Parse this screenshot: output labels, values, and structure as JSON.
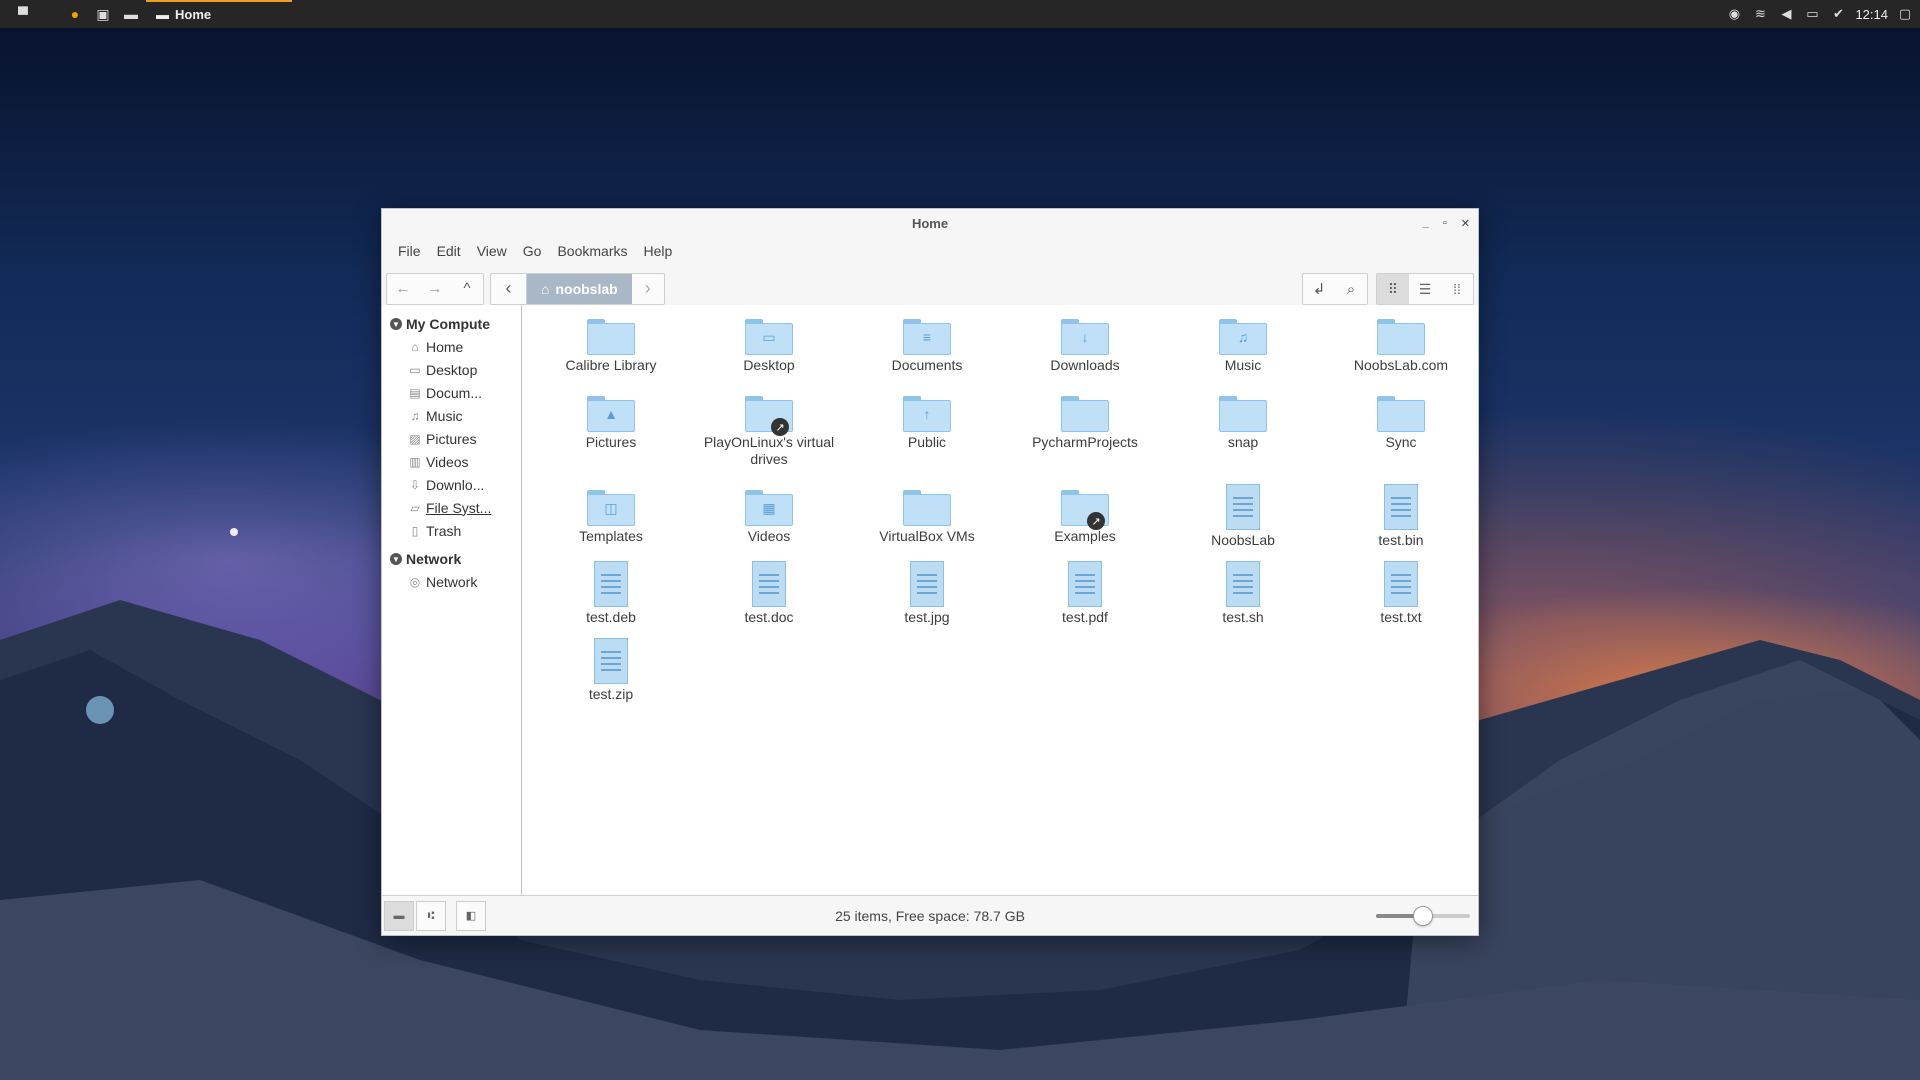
{
  "panel": {
    "task_label": "Home",
    "clock": "12:14"
  },
  "window": {
    "title": "Home",
    "menu": [
      "File",
      "Edit",
      "View",
      "Go",
      "Bookmarks",
      "Help"
    ],
    "breadcrumb": "noobslab",
    "sidebar": {
      "sections": [
        {
          "title": "My Compute",
          "items": [
            {
              "label": "Home",
              "icon": "home-icon"
            },
            {
              "label": "Desktop",
              "icon": "desktop-icon"
            },
            {
              "label": "Docum...",
              "icon": "document-icon"
            },
            {
              "label": "Music",
              "icon": "music-icon"
            },
            {
              "label": "Pictures",
              "icon": "picture-icon"
            },
            {
              "label": "Videos",
              "icon": "video-icon"
            },
            {
              "label": "Downlo...",
              "icon": "download-icon"
            },
            {
              "label": "File Syst...",
              "icon": "filesystem-icon"
            },
            {
              "label": "Trash",
              "icon": "trash-icon"
            }
          ]
        },
        {
          "title": "Network",
          "items": [
            {
              "label": "Network",
              "icon": "network-icon"
            }
          ]
        }
      ]
    },
    "files": [
      {
        "name": "Calibre Library",
        "kind": "folder",
        "glyph": ""
      },
      {
        "name": "Desktop",
        "kind": "folder",
        "glyph": "▭"
      },
      {
        "name": "Documents",
        "kind": "folder",
        "glyph": "≡"
      },
      {
        "name": "Downloads",
        "kind": "folder",
        "glyph": "↓"
      },
      {
        "name": "Music",
        "kind": "folder",
        "glyph": "♫"
      },
      {
        "name": "NoobsLab.com",
        "kind": "folder",
        "glyph": ""
      },
      {
        "name": "Pictures",
        "kind": "folder",
        "glyph": "▲"
      },
      {
        "name": "PlayOnLinux's virtual drives",
        "kind": "folder-link",
        "glyph": ""
      },
      {
        "name": "Public",
        "kind": "folder",
        "glyph": "↑"
      },
      {
        "name": "PycharmProjects",
        "kind": "folder",
        "glyph": ""
      },
      {
        "name": "snap",
        "kind": "folder",
        "glyph": ""
      },
      {
        "name": "Sync",
        "kind": "folder",
        "glyph": ""
      },
      {
        "name": "Templates",
        "kind": "folder",
        "glyph": "◫"
      },
      {
        "name": "Videos",
        "kind": "folder",
        "glyph": "▦"
      },
      {
        "name": "VirtualBox VMs",
        "kind": "folder",
        "glyph": ""
      },
      {
        "name": "Examples",
        "kind": "folder-link",
        "glyph": ""
      },
      {
        "name": "NoobsLab",
        "kind": "file"
      },
      {
        "name": "test.bin",
        "kind": "file"
      },
      {
        "name": "test.deb",
        "kind": "file"
      },
      {
        "name": "test.doc",
        "kind": "file"
      },
      {
        "name": "test.jpg",
        "kind": "file"
      },
      {
        "name": "test.pdf",
        "kind": "file"
      },
      {
        "name": "test.sh",
        "kind": "file"
      },
      {
        "name": "test.txt",
        "kind": "file"
      },
      {
        "name": "test.zip",
        "kind": "file"
      }
    ],
    "status": "25 items, Free space: 78.7 GB",
    "zoom_level": 0.5
  }
}
